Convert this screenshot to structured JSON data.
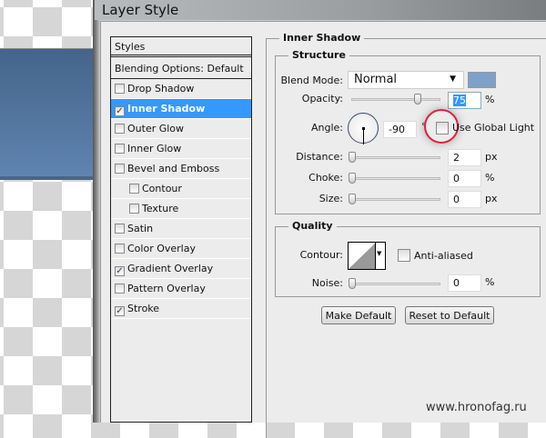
{
  "dialog": {
    "title": "Layer Style"
  },
  "styles_list": {
    "header": "Styles",
    "blending": "Blending Options: Default",
    "items": [
      {
        "label": "Drop Shadow",
        "checked": false,
        "indent": false
      },
      {
        "label": "Inner Shadow",
        "checked": true,
        "indent": false,
        "selected": true
      },
      {
        "label": "Outer Glow",
        "checked": false,
        "indent": false
      },
      {
        "label": "Inner Glow",
        "checked": false,
        "indent": false
      },
      {
        "label": "Bevel and Emboss",
        "checked": false,
        "indent": false
      },
      {
        "label": "Contour",
        "checked": false,
        "indent": true
      },
      {
        "label": "Texture",
        "checked": false,
        "indent": true
      },
      {
        "label": "Satin",
        "checked": false,
        "indent": false
      },
      {
        "label": "Color Overlay",
        "checked": false,
        "indent": false
      },
      {
        "label": "Gradient Overlay",
        "checked": true,
        "indent": false
      },
      {
        "label": "Pattern Overlay",
        "checked": false,
        "indent": false
      },
      {
        "label": "Stroke",
        "checked": true,
        "indent": false
      }
    ]
  },
  "inner_shadow": {
    "title": "Inner Shadow",
    "structure": {
      "title": "Structure",
      "blend_mode_label": "Blend Mode:",
      "blend_mode": "Normal",
      "shadow_color": "#7fa0c8",
      "opacity_label": "Opacity:",
      "opacity": "75",
      "opacity_unit": "%",
      "angle_label": "Angle:",
      "angle": "-90",
      "angle_unit": "°",
      "global_light_label": "Use Global Light",
      "global_light": false,
      "distance_label": "Distance:",
      "distance": "2",
      "distance_unit": "px",
      "choke_label": "Choke:",
      "choke": "0",
      "choke_unit": "%",
      "size_label": "Size:",
      "size": "0",
      "size_unit": "px"
    },
    "quality": {
      "title": "Quality",
      "contour_label": "Contour:",
      "anti_aliased_label": "Anti-aliased",
      "anti_aliased": false,
      "noise_label": "Noise:",
      "noise": "0",
      "noise_unit": "%"
    },
    "buttons": {
      "make_default": "Make Default",
      "reset_default": "Reset to Default"
    }
  },
  "watermark": "www.hronofag.ru"
}
